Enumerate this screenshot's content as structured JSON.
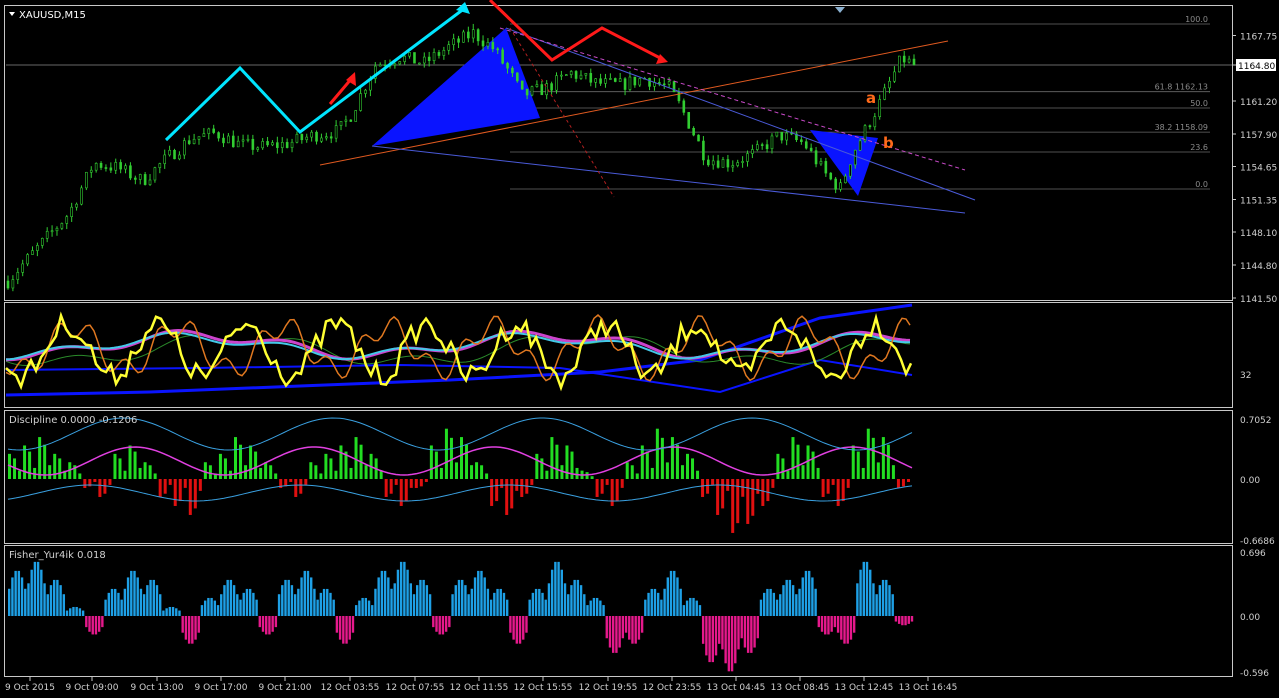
{
  "colors": {
    "background": "#000000",
    "frame": "#c8c8c8",
    "grid": "#5a5a5a",
    "candle": "#32cd32",
    "text": "#d0d0d0",
    "accent_red": "#ff1a1a",
    "accent_cyan": "#00e5ff",
    "accent_blue": "#0a14ff",
    "label_orange": "#ff6a1a",
    "fisher_up": "#1ea0e6",
    "fisher_down": "#e6198c",
    "disc_up": "#22dd22",
    "disc_down": "#e01010",
    "magenta_line": "#e040e0",
    "yellow_line": "#ffff33"
  },
  "chart_data": [
    {
      "type": "candlestick",
      "title": "XAUUSD,M15",
      "x_ticks": [
        "9 Oct 2015",
        "9 Oct 09:00",
        "9 Oct 13:00",
        "9 Oct 17:00",
        "9 Oct 21:00",
        "12 Oct 03:55",
        "12 Oct 07:55",
        "12 Oct 11:55",
        "12 Oct 15:55",
        "12 Oct 19:55",
        "12 Oct 23:55",
        "13 Oct 04:45",
        "13 Oct 08:45",
        "13 Oct 12:45",
        "13 Oct 16:45"
      ],
      "y_ticks": [
        "1167.75",
        "1164.80",
        "1161.20",
        "1157.90",
        "1154.65",
        "1151.35",
        "1148.10",
        "1144.80",
        "1141.50"
      ],
      "ylim": [
        1141.5,
        1170.5
      ],
      "current_price": "1164.80",
      "close_path": [
        [
          0,
          1143.2
        ],
        [
          12,
          1146.5
        ],
        [
          25,
          1150.0
        ],
        [
          35,
          1155.0
        ],
        [
          45,
          1154.5
        ],
        [
          55,
          1153.2
        ],
        [
          65,
          1155.5
        ],
        [
          75,
          1157.5
        ],
        [
          85,
          1158.0
        ],
        [
          95,
          1156.8
        ],
        [
          105,
          1156.6
        ],
        [
          115,
          1157.0
        ],
        [
          125,
          1157.8
        ],
        [
          135,
          1158.2
        ],
        [
          140,
          1159.8
        ],
        [
          150,
          1164.8
        ],
        [
          160,
          1165.6
        ],
        [
          170,
          1165.0
        ],
        [
          180,
          1166.6
        ],
        [
          190,
          1168.0
        ],
        [
          198,
          1166.5
        ],
        [
          205,
          1164.0
        ],
        [
          210,
          1161.8
        ],
        [
          220,
          1162.5
        ],
        [
          230,
          1164.0
        ],
        [
          240,
          1163.0
        ],
        [
          250,
          1162.8
        ],
        [
          260,
          1163.5
        ],
        [
          270,
          1162.5
        ],
        [
          275,
          1160.5
        ],
        [
          285,
          1155.5
        ],
        [
          295,
          1155.0
        ],
        [
          305,
          1156.0
        ],
        [
          315,
          1157.8
        ],
        [
          325,
          1157.0
        ],
        [
          335,
          1153.5
        ],
        [
          340,
          1152.5
        ],
        [
          345,
          1156.0
        ],
        [
          355,
          1160.5
        ],
        [
          365,
          1165.5
        ],
        [
          370,
          1164.8
        ]
      ],
      "fib_levels": [
        {
          "label": "100.0",
          "price": 1168.9
        },
        {
          "label": "61.8 1162.13",
          "price": 1162.13
        },
        {
          "label": "50.0",
          "price": 1160.5
        },
        {
          "label": "38.2 1158.09",
          "price": 1158.09
        },
        {
          "label": "23.6",
          "price": 1156.1
        },
        {
          "label": "0.0",
          "price": 1152.4
        }
      ],
      "annotations": [
        "a",
        "b"
      ]
    },
    {
      "type": "line",
      "title": "",
      "y_ticks": [
        "32"
      ]
    },
    {
      "type": "histogram",
      "title": "Discipline 0.0000 -0.1206",
      "y_ticks": [
        "0.7052",
        "0.00",
        "-0.6686"
      ],
      "ylim": [
        -0.6686,
        0.7052
      ],
      "values": [
        0.3,
        0.4,
        0.5,
        0.3,
        0.2,
        -0.1,
        -0.2,
        0.3,
        0.4,
        0.2,
        -0.2,
        -0.3,
        -0.4,
        0.2,
        0.3,
        0.5,
        0.4,
        0.2,
        -0.1,
        -0.2,
        0.2,
        0.3,
        0.4,
        0.5,
        0.3,
        -0.2,
        -0.3,
        -0.1,
        0.4,
        0.6,
        0.5,
        0.2,
        -0.3,
        -0.4,
        -0.2,
        0.3,
        0.5,
        0.4,
        0.1,
        -0.2,
        -0.3,
        0.2,
        0.4,
        0.6,
        0.5,
        0.3,
        -0.2,
        -0.4,
        -0.6,
        -0.5,
        -0.3,
        0.3,
        0.5,
        0.4,
        -0.2,
        -0.3,
        0.4,
        0.6,
        0.5,
        -0.1
      ]
    },
    {
      "type": "histogram",
      "title": "Fisher_Yur4ik 0.018",
      "y_ticks": [
        "0.696",
        "0.00",
        "-0.596"
      ],
      "ylim": [
        -0.596,
        0.696
      ],
      "values": [
        0.5,
        0.6,
        0.4,
        0.1,
        -0.2,
        0.3,
        0.5,
        0.4,
        0.1,
        -0.3,
        0.2,
        0.4,
        0.3,
        -0.2,
        0.4,
        0.5,
        0.3,
        -0.3,
        0.2,
        0.5,
        0.6,
        0.4,
        -0.2,
        0.4,
        0.5,
        0.3,
        -0.3,
        0.3,
        0.6,
        0.4,
        0.2,
        -0.4,
        -0.3,
        0.3,
        0.5,
        0.2,
        -0.5,
        -0.6,
        -0.4,
        0.3,
        0.4,
        0.5,
        -0.2,
        -0.3,
        0.6,
        0.4,
        -0.1
      ]
    }
  ]
}
